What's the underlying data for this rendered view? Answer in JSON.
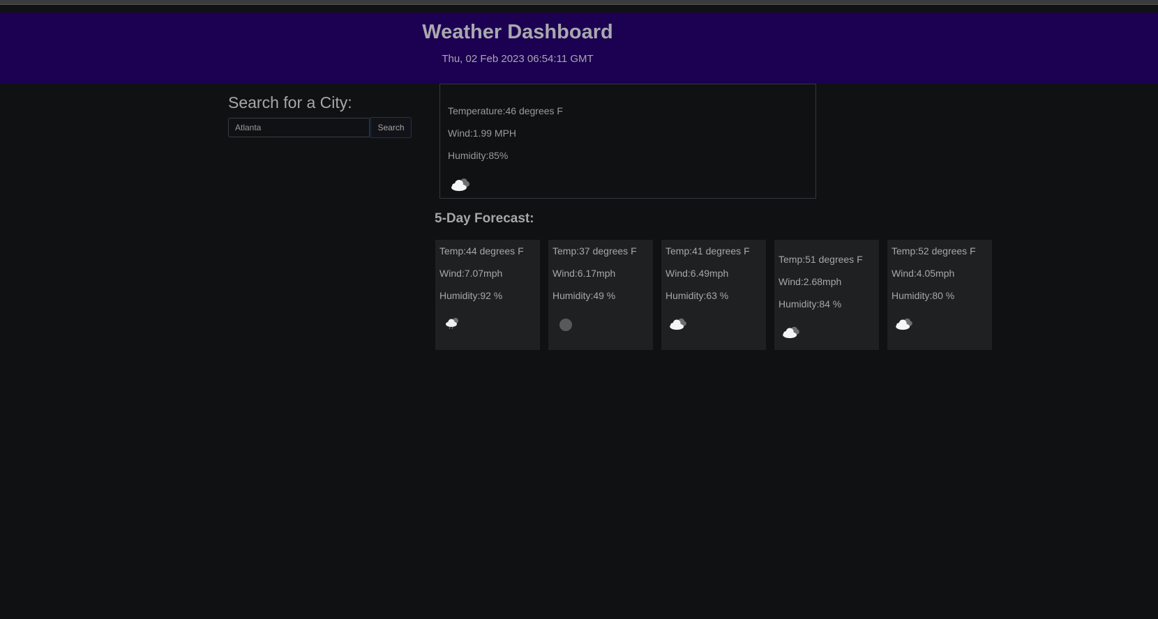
{
  "header": {
    "title": "Weather Dashboard",
    "datetime": "Thu, 02 Feb 2023 06:54:11 GMT"
  },
  "search": {
    "heading": "Search for a City:",
    "input_value": "Atlanta",
    "button_label": "Search"
  },
  "current": {
    "temperature": "Temperature:46 degrees F",
    "wind": "Wind:1.99 MPH",
    "humidity": "Humidity:85%",
    "icon": "cloudy-icon"
  },
  "forecast": {
    "heading": "5-Day Forecast:",
    "days": [
      {
        "temp": "Temp:44 degrees F",
        "wind": "Wind:7.07mph",
        "humidity": "Humidity:92 %",
        "icon": "light-rain-icon"
      },
      {
        "temp": "Temp:37 degrees F",
        "wind": "Wind:6.17mph",
        "humidity": "Humidity:49 %",
        "icon": "clear-night-icon"
      },
      {
        "temp": "Temp:41 degrees F",
        "wind": "Wind:6.49mph",
        "humidity": "Humidity:63 %",
        "icon": "cloudy-icon"
      },
      {
        "temp": "Temp:51 degrees F",
        "wind": "Wind:2.68mph",
        "humidity": "Humidity:84 %",
        "icon": "cloudy-icon"
      },
      {
        "temp": "Temp:52 degrees F",
        "wind": "Wind:4.05mph",
        "humidity": "Humidity:80 %",
        "icon": "cloudy-icon"
      }
    ]
  },
  "colors": {
    "header_bg": "#1c0052",
    "page_bg": "#101113",
    "card_bg": "#1f2022"
  }
}
